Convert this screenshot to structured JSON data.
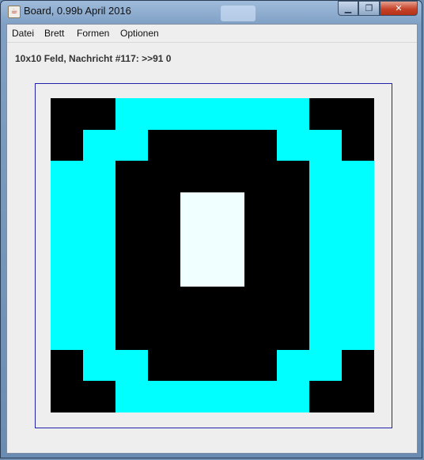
{
  "window": {
    "title": "Board, 0.99b April 2016",
    "controls": {
      "minimize": "▁",
      "maximize": "❐",
      "close": "✕"
    }
  },
  "menu": {
    "items": [
      {
        "label": "Datei"
      },
      {
        "label": "Brett"
      },
      {
        "label": "Formen"
      },
      {
        "label": "Optionen"
      }
    ]
  },
  "status": {
    "text": "10x10 Feld, Nachricht #117: >>91 0"
  },
  "colors": {
    "black": "#000000",
    "cyan": "#00FFFF",
    "light": "#F0FFFF"
  },
  "board": {
    "cols": 10,
    "rows": 10,
    "grid": [
      [
        "black",
        "black",
        "cyan",
        "cyan",
        "cyan",
        "cyan",
        "cyan",
        "cyan",
        "black",
        "black"
      ],
      [
        "black",
        "cyan",
        "cyan",
        "black",
        "black",
        "black",
        "black",
        "cyan",
        "cyan",
        "black"
      ],
      [
        "cyan",
        "cyan",
        "black",
        "black",
        "black",
        "black",
        "black",
        "black",
        "cyan",
        "cyan"
      ],
      [
        "cyan",
        "cyan",
        "black",
        "black",
        "light",
        "light",
        "black",
        "black",
        "cyan",
        "cyan"
      ],
      [
        "cyan",
        "cyan",
        "black",
        "black",
        "light",
        "light",
        "black",
        "black",
        "cyan",
        "cyan"
      ],
      [
        "cyan",
        "cyan",
        "black",
        "black",
        "light",
        "light",
        "black",
        "black",
        "cyan",
        "cyan"
      ],
      [
        "cyan",
        "cyan",
        "black",
        "black",
        "black",
        "black",
        "black",
        "black",
        "cyan",
        "cyan"
      ],
      [
        "cyan",
        "cyan",
        "black",
        "black",
        "black",
        "black",
        "black",
        "black",
        "cyan",
        "cyan"
      ],
      [
        "black",
        "cyan",
        "cyan",
        "black",
        "black",
        "black",
        "black",
        "cyan",
        "cyan",
        "black"
      ],
      [
        "black",
        "black",
        "cyan",
        "cyan",
        "cyan",
        "cyan",
        "cyan",
        "cyan",
        "black",
        "black"
      ]
    ]
  }
}
